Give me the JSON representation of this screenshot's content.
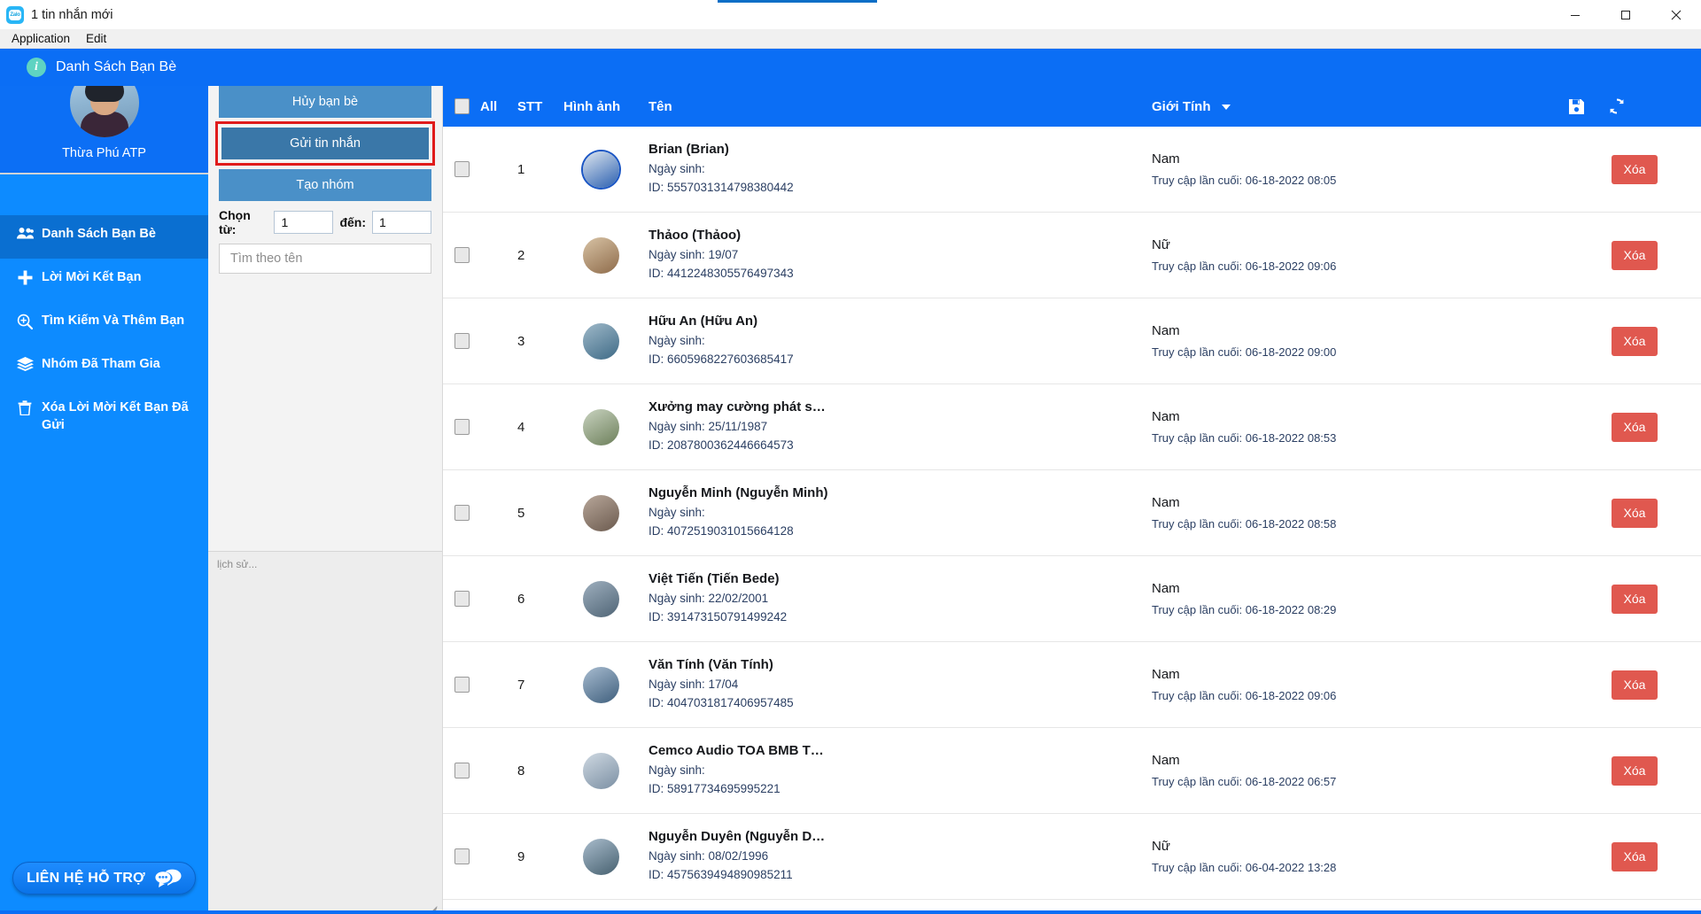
{
  "window": {
    "title": "1 tin nhắn mới",
    "app_icon": "zalo-icon",
    "minimize": "minimize",
    "maximize": "maximize",
    "close": "close"
  },
  "menubar": {
    "items": [
      "Application",
      "Edit"
    ]
  },
  "sidebar": {
    "profile": {
      "name": "Thừa Phú ATP",
      "avatar": "user-avatar"
    },
    "items": [
      {
        "label": "Danh Sách Bạn Bè",
        "icon": "users-icon",
        "active": true
      },
      {
        "label": "Lời Mời Kết Bạn",
        "icon": "plus-icon",
        "active": false
      },
      {
        "label": "Tìm Kiếm Và Thêm Bạn",
        "icon": "search-plus-icon",
        "active": false
      },
      {
        "label": "Nhóm Đã Tham Gia",
        "icon": "layers-icon",
        "active": false
      },
      {
        "label": "Xóa Lời Mời Kết Bạn Đã Gửi",
        "icon": "trash-icon",
        "active": false
      }
    ],
    "support_button": {
      "label": "LIÊN HỆ HỖ TRỢ",
      "icon": "chat-bubbles-icon"
    }
  },
  "midpanel": {
    "buttons": [
      {
        "label": "Hủy bạn bè",
        "selected": false
      },
      {
        "label": "Gửi tin nhắn",
        "selected": true
      },
      {
        "label": "Tạo nhóm",
        "selected": false
      }
    ],
    "range": {
      "from_label": "Chọn từ:",
      "from_value": "1",
      "to_label": "đến:",
      "to_value": "1"
    },
    "search_placeholder": "Tìm theo tên",
    "search_value": "",
    "history_text": "lịch sử..."
  },
  "header": {
    "title": "Danh Sách Bạn Bè",
    "icon": "info-icon"
  },
  "table": {
    "columns": {
      "all": "All",
      "stt": "STT",
      "image": "Hình ảnh",
      "name": "Tên",
      "gender": "Giới Tính"
    },
    "header_icons": [
      {
        "name": "save-icon"
      },
      {
        "name": "refresh-icon"
      }
    ],
    "labels": {
      "birthday": "Ngày sinh:",
      "id": "ID:",
      "last_access": "Truy cập lần cuối:",
      "delete": "Xóa"
    },
    "rows": [
      {
        "stt": "1",
        "name": "Brian (Brian)",
        "birthday": "Ngày sinh:",
        "id": "ID: 5557031314798380442",
        "gender": "Nam",
        "last_access": "Truy cập lần cuối: 06-18-2022 08:05",
        "delete": "Xóa"
      },
      {
        "stt": "2",
        "name": "Thảoo (Thảoo)",
        "birthday": "Ngày sinh: 19/07",
        "id": "ID: 4412248305576497343",
        "gender": "Nữ",
        "last_access": "Truy cập lần cuối: 06-18-2022 09:06",
        "delete": "Xóa"
      },
      {
        "stt": "3",
        "name": "Hữu An (Hữu An)",
        "birthday": "Ngày sinh:",
        "id": "ID: 6605968227603685417",
        "gender": "Nam",
        "last_access": "Truy cập lần cuối: 06-18-2022 09:00",
        "delete": "Xóa"
      },
      {
        "stt": "4",
        "name": "Xưởng may cường phát s…",
        "birthday": "Ngày sinh: 25/11/1987",
        "id": "ID: 2087800362446664573",
        "gender": "Nam",
        "last_access": "Truy cập lần cuối: 06-18-2022 08:53",
        "delete": "Xóa"
      },
      {
        "stt": "5",
        "name": "Nguyễn Minh (Nguyễn Minh)",
        "birthday": "Ngày sinh:",
        "id": "ID: 4072519031015664128",
        "gender": "Nam",
        "last_access": "Truy cập lần cuối: 06-18-2022 08:58",
        "delete": "Xóa"
      },
      {
        "stt": "6",
        "name": "Việt Tiến (Tiến Bede)",
        "birthday": "Ngày sinh: 22/02/2001",
        "id": "ID: 391473150791499242",
        "gender": "Nam",
        "last_access": "Truy cập lần cuối: 06-18-2022 08:29",
        "delete": "Xóa"
      },
      {
        "stt": "7",
        "name": "Văn Tính (Văn Tính)",
        "birthday": "Ngày sinh: 17/04",
        "id": "ID: 4047031817406957485",
        "gender": "Nam",
        "last_access": "Truy cập lần cuối: 06-18-2022 09:06",
        "delete": "Xóa"
      },
      {
        "stt": "8",
        "name": "Cemco Audio TOA BMB T…",
        "birthday": "Ngày sinh:",
        "id": "ID: 58917734695995221",
        "gender": "Nam",
        "last_access": "Truy cập lần cuối: 06-18-2022 06:57",
        "delete": "Xóa"
      },
      {
        "stt": "9",
        "name": "Nguyễn Duyên (Nguyễn D…",
        "birthday": "Ngày sinh: 08/02/1996",
        "id": "ID: 4575639494890985211",
        "gender": "Nữ",
        "last_access": "Truy cập lần cuối: 06-04-2022 13:28",
        "delete": "Xóa"
      }
    ]
  },
  "colors": {
    "brand_blue": "#0b6ef5",
    "sidebar_blue": "#0d8bff",
    "sidebar_active": "#0a6fd1",
    "button_blue": "#4a90c8",
    "button_selected": "#3a77a8",
    "highlight_red": "#e01b1b",
    "delete_red": "#e0584f"
  }
}
